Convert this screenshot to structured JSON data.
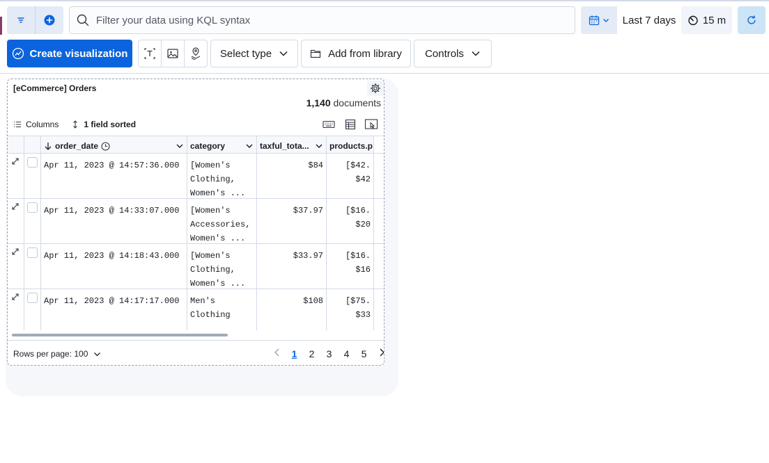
{
  "query": {
    "placeholder": "Filter your data using KQL syntax"
  },
  "time": {
    "range_label": "Last 7 days",
    "refresh_interval": "15 m"
  },
  "toolbar": {
    "create_label": "Create visualization",
    "select_type_label": "Select type",
    "add_library_label": "Add from library",
    "controls_label": "Controls"
  },
  "panel": {
    "title": "[eCommerce] Orders",
    "doc_count": "1,140",
    "doc_suffix": "documents",
    "columns_label": "Columns",
    "sorted_label": "1 field sorted",
    "headers": {
      "order_date": "order_date",
      "category": "category",
      "taxful_total": "taxful_tota...",
      "products": "products.p"
    },
    "rows": [
      {
        "date": "Apr 11, 2023 @ 14:57:36.000",
        "category_lines": [
          "[Women's",
          "Clothing,",
          "Women's ..."
        ],
        "total": "$84",
        "products_lines": [
          "[$42.",
          "$42"
        ]
      },
      {
        "date": "Apr 11, 2023 @ 14:33:07.000",
        "category_lines": [
          "[Women's",
          "Accessories,",
          "Women's ..."
        ],
        "total": "$37.97",
        "products_lines": [
          "[$16.",
          "$20"
        ]
      },
      {
        "date": "Apr 11, 2023 @ 14:18:43.000",
        "category_lines": [
          "[Women's",
          "Clothing,",
          "Women's ..."
        ],
        "total": "$33.97",
        "products_lines": [
          "[$16.",
          "$16"
        ]
      },
      {
        "date": "Apr 11, 2023 @ 14:17:17.000",
        "category_lines": [
          "Men's",
          "Clothing"
        ],
        "total": "$108",
        "products_lines": [
          "[$75.",
          "$33"
        ]
      }
    ],
    "rows_per_page": "Rows per page: 100",
    "pages": [
      "1",
      "2",
      "3",
      "4",
      "5"
    ],
    "active_page": "1"
  },
  "colors": {
    "primary": "#0b64dd",
    "border": "#d3dae6",
    "refresh_bg": "#cce4f5"
  }
}
